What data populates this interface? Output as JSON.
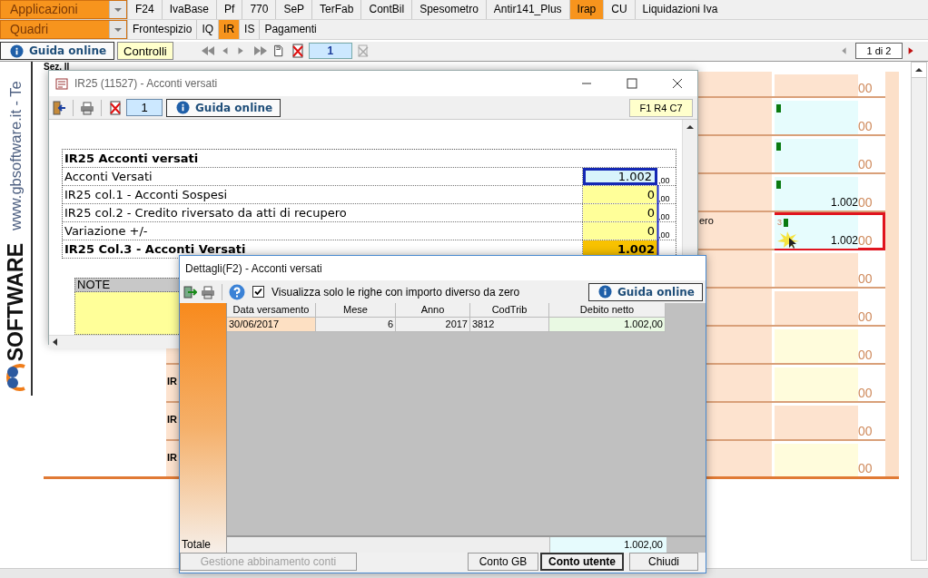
{
  "applications_menu": {
    "label": "Applicazioni",
    "tabs": [
      {
        "label": "F24",
        "selected": false
      },
      {
        "label": "IvaBase",
        "selected": false
      },
      {
        "label": "Pf",
        "selected": false
      },
      {
        "label": "770",
        "selected": false
      },
      {
        "label": "SeP",
        "selected": false
      },
      {
        "label": "TerFab",
        "selected": false
      },
      {
        "label": "ContBil",
        "selected": false
      },
      {
        "label": "Spesometro",
        "selected": false
      },
      {
        "label": "Antir141_Plus",
        "selected": false
      },
      {
        "label": "Irap",
        "selected": true
      },
      {
        "label": "CU",
        "selected": false
      },
      {
        "label": "Liquidazioni Iva",
        "selected": false
      }
    ]
  },
  "sections_menu": {
    "label": "Quadri",
    "tabs": [
      {
        "label": "Frontespizio",
        "selected": false
      },
      {
        "label": "IQ",
        "selected": false
      },
      {
        "label": "IR",
        "selected": true
      },
      {
        "label": "IS",
        "selected": false
      },
      {
        "label": "Pagamenti",
        "selected": false
      }
    ]
  },
  "toolbar": {
    "help_button": "Guida online",
    "checks_button": "Controlli",
    "page": "1",
    "page_count": "1 di 2"
  },
  "sidebar": {
    "website": "www.gbsoftware.it - Te",
    "brand": "SOFTWARE"
  },
  "form": {
    "section": "Sez. II",
    "rows": [
      {
        "kind": "peach",
        "cents": "00",
        "marker": false,
        "highlighted": false
      },
      {
        "kind": "cyan",
        "cents": "00",
        "marker": true,
        "highlighted": false
      },
      {
        "kind": "cyan",
        "cents": "00",
        "marker": true,
        "highlighted": false
      },
      {
        "kind": "cyan",
        "value": "1.002",
        "cents": "00",
        "marker": true,
        "highlighted": false
      },
      {
        "kind": "cyan",
        "tail": "ero",
        "note": "3",
        "value": "1.002",
        "cents": "00",
        "marker": true,
        "highlighted": true
      },
      {
        "kind": "peach",
        "cents": "00",
        "marker": false,
        "highlighted": false
      },
      {
        "kind": "peach",
        "cents": "00",
        "marker": false,
        "highlighted": false
      },
      {
        "kind": "yellow",
        "cents": "00",
        "marker": false,
        "highlighted": false
      },
      {
        "kind": "yellow",
        "code": "IR",
        "cents": "00",
        "marker": false,
        "highlighted": false
      },
      {
        "kind": "peach",
        "code": "IR",
        "cents": "00",
        "marker": false,
        "highlighted": false
      },
      {
        "kind": "yellow",
        "code": "IR",
        "cents": "00",
        "marker": false,
        "highlighted": false
      }
    ]
  },
  "ir25_dialog": {
    "title": "IR25 (11527) - Acconti versati",
    "page": "1",
    "help_button": "Guida online",
    "position": "F1 R4 C7",
    "heading": "IR25 Acconti versati",
    "rows": [
      {
        "kind": "input",
        "label": "Acconti Versati",
        "value": "1.002",
        "cents": ",00",
        "selected": true
      },
      {
        "kind": "input",
        "label": "IR25 col.1  - Acconti Sospesi",
        "value": "0",
        "cents": ",00",
        "selected": false
      },
      {
        "kind": "input",
        "label": "IR25 col.2  - Credito riversato da atti di recupero",
        "value": "0",
        "cents": ",00",
        "selected": false
      },
      {
        "kind": "input",
        "label": "Variazione +/-",
        "value": "0",
        "cents": ",00",
        "selected": false
      },
      {
        "kind": "total",
        "label": "IR25 Col.3 - Acconti Versati",
        "value": "1.002",
        "selected": false
      }
    ],
    "notes_label": "NOTE"
  },
  "details_dialog": {
    "title": "Dettagli(F2) - Acconti versati",
    "filter": {
      "label": "Visualizza solo le righe con importo diverso da zero",
      "checked": true
    },
    "help_button": "Guida online",
    "columns": [
      "Data versamento",
      "Mese",
      "Anno",
      "CodTrib",
      "Debito netto"
    ],
    "rows": [
      {
        "cells": [
          "30/06/2017",
          "6",
          "2017",
          "3812",
          "1.002,00"
        ]
      }
    ],
    "total_label": "Totale",
    "total": "1.002,00",
    "buttons": [
      {
        "label": "Gestione abbinamento conti",
        "disabled": true,
        "default": false
      },
      {
        "label": "Conto GB",
        "disabled": false,
        "default": false
      },
      {
        "label": "Conto utente",
        "disabled": false,
        "default": true
      },
      {
        "label": "Chiudi",
        "disabled": false,
        "default": false
      }
    ]
  }
}
